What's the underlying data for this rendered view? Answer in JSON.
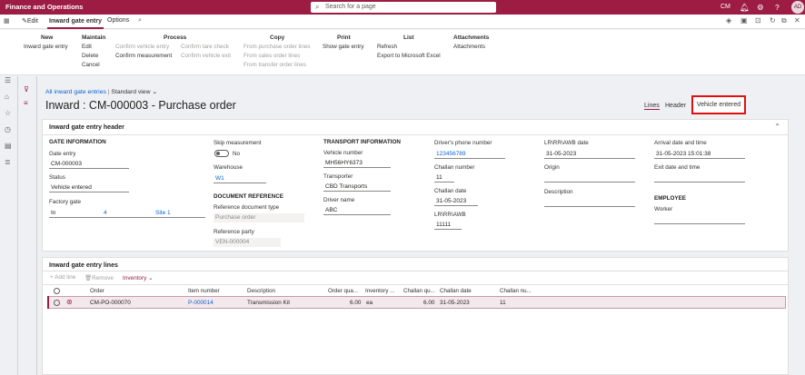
{
  "topbar": {
    "app_name": "Finance and Operations",
    "search_placeholder": "Search for a page",
    "company": "CM",
    "avatar": "AD",
    "icons": [
      "bell-icon",
      "gear-icon",
      "help-icon"
    ]
  },
  "actionbar": {
    "edit": "Edit",
    "tab_active": "Inward gate entry",
    "options": "Options"
  },
  "ribbon": {
    "groups": [
      {
        "title": "New",
        "items": [
          {
            "label": "Inward gate entry",
            "enabled": true
          }
        ]
      },
      {
        "title": "Maintain",
        "items": [
          {
            "label": "Edit",
            "enabled": true
          },
          {
            "label": "Delete",
            "enabled": true
          },
          {
            "label": "Cancel",
            "enabled": true
          }
        ]
      },
      {
        "title": "Process",
        "items": [
          {
            "label": "Confirm vehicle entry",
            "enabled": false
          },
          {
            "label": "Confirm tare check",
            "enabled": false
          },
          {
            "label": "Confirm measurement",
            "enabled": true
          },
          {
            "label": "Confirm vehicle exit",
            "enabled": false
          }
        ]
      },
      {
        "title": "Copy",
        "items": [
          {
            "label": "From purchase order lines",
            "enabled": false
          },
          {
            "label": "From sales order lines",
            "enabled": false
          },
          {
            "label": "From transfer order lines",
            "enabled": false
          }
        ]
      },
      {
        "title": "Print",
        "items": [
          {
            "label": "Show gate entry",
            "enabled": true
          }
        ]
      },
      {
        "title": "List",
        "items": [
          {
            "label": "Refresh",
            "enabled": true
          },
          {
            "label": "Export to Microsoft Excel",
            "enabled": true
          }
        ]
      },
      {
        "title": "Attachments",
        "items": [
          {
            "label": "Attachments",
            "enabled": true
          }
        ]
      }
    ]
  },
  "breadcrumb": {
    "link": "All inward gate entries",
    "view": "Standard view"
  },
  "page": {
    "title": "Inward : CM-000003 - Purchase order",
    "tab_lines": "Lines",
    "tab_header": "Header",
    "status": "Vehicle entered"
  },
  "header_panel": {
    "title": "Inward gate entry header",
    "gate_info": {
      "title": "GATE INFORMATION",
      "gate_entry_label": "Gate entry",
      "gate_entry": "CM-000003",
      "status_label": "Status",
      "status": "Vehicle entered",
      "factory_gate_label": "Factory gate",
      "factory_gate_in": "In",
      "factory_gate_num": "4",
      "factory_gate_site": "Site 1"
    },
    "col2": {
      "skip_label": "Skip measurement",
      "skip_value": "No",
      "warehouse_label": "Warehouse",
      "warehouse": "W1",
      "doc_ref_title": "DOCUMENT REFERENCE",
      "ref_doc_type_label": "Reference document type",
      "ref_doc_type": "Purchase order",
      "ref_party_label": "Reference party",
      "ref_party": "VEN-000004"
    },
    "transport": {
      "title": "TRANSPORT INFORMATION",
      "vehicle_no_label": "Vehicle number",
      "vehicle_no": "MH56HY6373",
      "transporter_label": "Transporter",
      "transporter": "CBD Transports",
      "driver_label": "Driver name",
      "driver": "ABC"
    },
    "col4": {
      "phone_label": "Driver's phone number",
      "phone": "123456789",
      "challan_no_label": "Challan number",
      "challan_no": "11",
      "challan_date_label": "Challan date",
      "challan_date": "31-05-2023",
      "lr_label": "LR\\RR\\AWB",
      "lr": "11111"
    },
    "col5": {
      "lr_date_label": "LR\\RR\\AWB date",
      "lr_date": "31-05-2023",
      "origin_label": "Origin",
      "origin": "",
      "desc_label": "Description",
      "desc": ""
    },
    "col6": {
      "arrival_label": "Arrival date and time",
      "arrival": "31-05-2023 15:01:38",
      "exit_label": "Exit date and time",
      "exit": "",
      "employee_title": "EMPLOYEE",
      "worker_label": "Worker",
      "worker": ""
    }
  },
  "lines_panel": {
    "title": "Inward gate entry lines",
    "toolbar": {
      "add": "+ Add line",
      "remove": "Remove",
      "inventory": "Inventory"
    },
    "columns": [
      "Order",
      "Item number",
      "Description",
      "Order qua...",
      "Inventory ...",
      "Challan qu...",
      "Challan date",
      "Challan nu..."
    ],
    "rows": [
      {
        "order": "CM-PO-000070",
        "item": "P-000014",
        "description": "Transmission Kit",
        "order_qty": "6.00",
        "unit": "ea",
        "challan_qty": "6.00",
        "challan_date": "31-05-2023",
        "challan_no": "11"
      }
    ]
  }
}
